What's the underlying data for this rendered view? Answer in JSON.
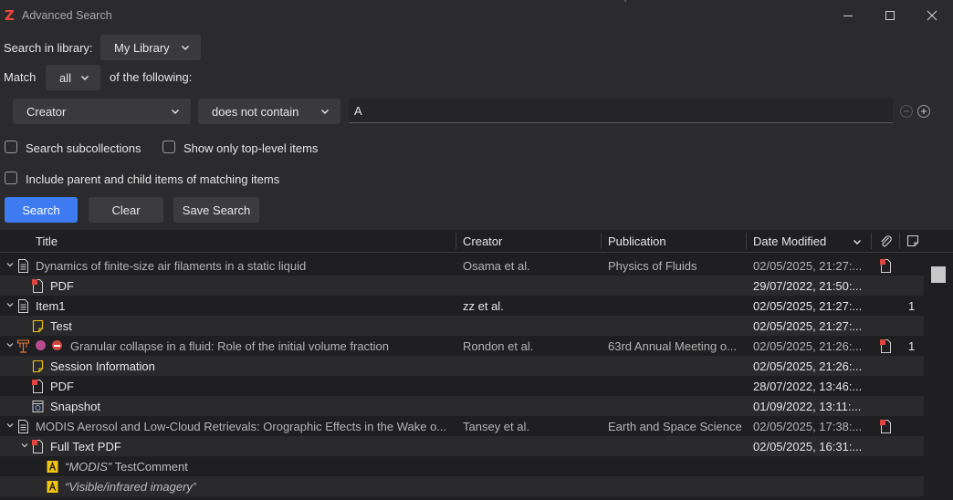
{
  "window": {
    "title": "Advanced Search",
    "logo_letter": "Z",
    "controls": [
      "minimize",
      "maximize",
      "close"
    ]
  },
  "search": {
    "library_label": "Search in library:",
    "library_value": "My Library",
    "match_label": "Match",
    "match_value": "all",
    "following_label": "of the following:",
    "condition": {
      "field": "Creator",
      "operator": "does not contain",
      "value": "A"
    },
    "options": [
      {
        "label": "Search subcollections",
        "checked": false
      },
      {
        "label": "Show only top-level items",
        "checked": false
      },
      {
        "label": "Include parent and child items of matching items",
        "checked": false
      }
    ],
    "buttons": {
      "search": "Search",
      "clear": "Clear",
      "save": "Save Search"
    }
  },
  "columns": {
    "title": "Title",
    "creator": "Creator",
    "publication": "Publication",
    "date_modified": "Date Modified"
  },
  "rows": [
    {
      "title": "Dynamics of finite-size air filaments in a static liquid",
      "creator": "Osama et al.",
      "publication": "Physics of Fluids",
      "date": "02/05/2025, 21:27:...",
      "attachment": "pdf",
      "notes": "",
      "kind": "journal",
      "level": 0,
      "expanded": true,
      "dim": true
    },
    {
      "title": "PDF",
      "creator": "",
      "publication": "",
      "date": "29/07/2022, 21:50:...",
      "kind": "pdf",
      "level": 1
    },
    {
      "title": "Item1",
      "creator": "zz et al.",
      "publication": "",
      "date": "02/05/2025, 21:27:...",
      "attachment": "",
      "notes": "1",
      "kind": "document",
      "level": 0,
      "expanded": true
    },
    {
      "title": "Test",
      "creator": "",
      "publication": "",
      "date": "02/05/2025, 21:27:...",
      "kind": "note",
      "level": 1
    },
    {
      "title": "Granular collapse in a fluid: Role of the initial volume fraction",
      "creator": "Rondon et al.",
      "publication": "63rd Annual Meeting o...",
      "date": "02/05/2025, 21:26:...",
      "attachment": "pdf",
      "notes": "1",
      "kind": "presentation",
      "level": 0,
      "expanded": true,
      "dim": true,
      "tags": [
        "#b84b8e",
        "#d0473e"
      ]
    },
    {
      "title": "Session Information",
      "creator": "",
      "publication": "",
      "date": "02/05/2025, 21:26:...",
      "kind": "note",
      "level": 1
    },
    {
      "title": "PDF",
      "creator": "",
      "publication": "",
      "date": "28/07/2022, 13:46:...",
      "kind": "pdf",
      "level": 1
    },
    {
      "title": "Snapshot",
      "creator": "",
      "publication": "",
      "date": "01/09/2022, 13:11:...",
      "kind": "snapshot",
      "level": 1
    },
    {
      "title": "MODIS Aerosol and Low-Cloud Retrievals: Orographic Effects in the Wake o...",
      "creator": "Tansey et al.",
      "publication": "Earth and Space Science",
      "date": "02/05/2025, 17:38:...",
      "attachment": "pdf",
      "notes": "",
      "kind": "journal",
      "level": 0,
      "expanded": true,
      "dim": true
    },
    {
      "title": "Full Text PDF",
      "creator": "",
      "publication": "",
      "date": "02/05/2025, 16:31:...",
      "kind": "pdf",
      "level": 1,
      "expanded": true
    },
    {
      "title_quote": "“MODIS”",
      "title": " TestComment",
      "kind": "annotation",
      "level": 2
    },
    {
      "title_quote": "“Visible/infrared imagery”",
      "title": "",
      "kind": "annotation",
      "level": 2
    }
  ],
  "colors": {
    "accent": "#3e7bf0",
    "logo": "#e8463d",
    "pdf_icon": "#e0453e",
    "annotation": "#f2c511"
  }
}
